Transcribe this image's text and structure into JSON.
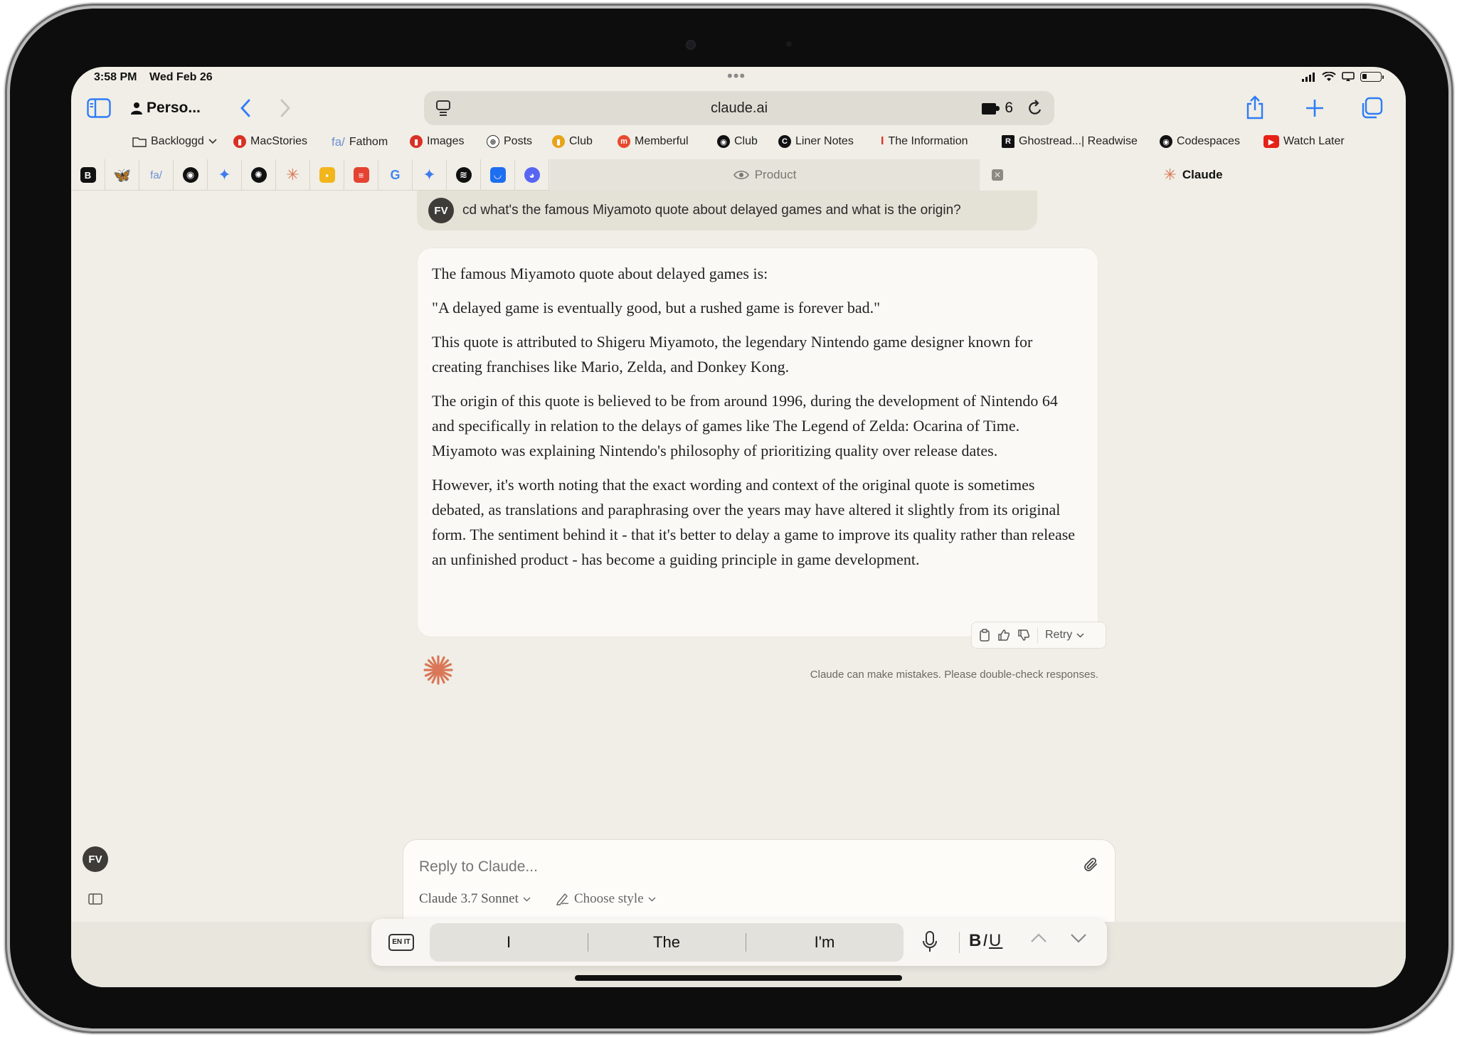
{
  "status": {
    "time": "3:58 PM",
    "date": "Wed Feb 26"
  },
  "toolbar": {
    "profile": "Perso...",
    "url": "claude.ai",
    "extensions_count": "6"
  },
  "favorites": [
    {
      "label": "Backloggd",
      "icon": "folder-icon"
    },
    {
      "label": "MacStories",
      "icon": "macstories-icon",
      "color": "#d93025"
    },
    {
      "label": "Fathom",
      "icon": "fathom-icon",
      "color": "#6e8fd6"
    },
    {
      "label": "Images",
      "icon": "bookmark-icon",
      "color": "#d93025"
    },
    {
      "label": "Posts",
      "icon": "globe-icon"
    },
    {
      "label": "Club",
      "icon": "club-icon",
      "color": "#e8a317"
    },
    {
      "label": "Memberful",
      "icon": "memberful-icon",
      "color": "#e8492f"
    },
    {
      "label": "Club",
      "icon": "github-icon"
    },
    {
      "label": "Liner Notes",
      "icon": "c-icon"
    },
    {
      "label": "The Information",
      "icon": "information-icon",
      "color": "#d93025"
    },
    {
      "label": "Ghostread...| Readwise",
      "icon": "readwise-icon"
    },
    {
      "label": "Codespaces",
      "icon": "github-icon"
    },
    {
      "label": "Watch Later",
      "icon": "youtube-icon",
      "color": "#e62117"
    }
  ],
  "tabs": {
    "product_label": "Product",
    "claude_label": "Claude"
  },
  "chat": {
    "user_initials": "FV",
    "user_message": "cd what's the famous Miyamoto quote about delayed games and what is the origin?",
    "reply_paragraphs": [
      "The famous Miyamoto quote about delayed games is:",
      "\"A delayed game is eventually good, but a rushed game is forever bad.\"",
      "This quote is attributed to Shigeru Miyamoto, the legendary Nintendo game designer known for creating franchises like Mario, Zelda, and Donkey Kong.",
      "The origin of this quote is believed to be from around 1996, during the development of Nintendo 64 and specifically in relation to the delays of games like The Legend of Zelda: Ocarina of Time. Miyamoto was explaining Nintendo's philosophy of prioritizing quality over release dates.",
      "However, it's worth noting that the exact wording and context of the original quote is sometimes debated, as translations and paraphrasing over the years may have altered it slightly from its original form. The sentiment behind it - that it's better to delay a game to improve its quality rather than release an unfinished product - has become a guiding principle in game development."
    ],
    "retry_label": "Retry",
    "disclaimer": "Claude can make mistakes. Please double-check responses."
  },
  "composer": {
    "placeholder": "Reply to Claude...",
    "model": "Claude 3.7 Sonnet",
    "style": "Choose style"
  },
  "sidebar": {
    "initials": "FV"
  },
  "keyboard": {
    "lang": "EN IT",
    "predictions": [
      "I",
      "The",
      "I'm"
    ],
    "format": "BIU"
  },
  "colors": {
    "accent": "#2f7cf6",
    "claude_orange": "#d97757",
    "background": "#f0eee6"
  }
}
